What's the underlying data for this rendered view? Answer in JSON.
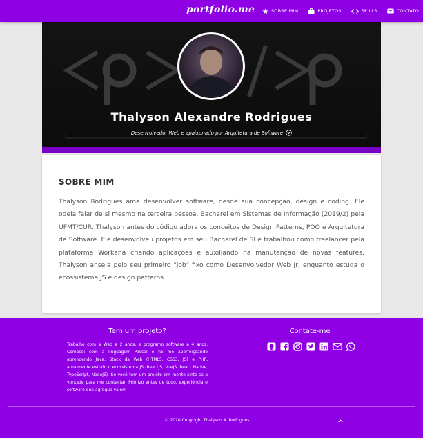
{
  "navbar": {
    "brand": "portfolio.me",
    "items": [
      {
        "label": "SOBRE MIM",
        "icon": "star-icon"
      },
      {
        "label": "PROJETOS",
        "icon": "briefcase-icon"
      },
      {
        "label": "SKILLS",
        "icon": "code-icon"
      },
      {
        "label": "CONTATO",
        "icon": "envelope-icon"
      }
    ]
  },
  "hero": {
    "name": "Thalyson Alexandre Rodrigues",
    "role": "Desenvolvedor Web e apaixonado por Arquitetura de Software",
    "role_icon": "chevron-circle-down-icon"
  },
  "about": {
    "title": "SOBRE MIM",
    "text": "Thalyson Rodrigues ama desenvolver software, desde sua concepção, design e coding. Ele odeia falar de si mesmo na terceira pessoa. Bacharel em Sistemas de Informação (2019/2) pela UFMT/CUR. Thalyson antes do código adora os conceitos de Design Patterns, POO e Arquitetura de Software. Ele desenvolveu projetos em seu Bacharel de SI e trabalhou como freelancer pela plataforma Workana criando aplicações e auxiliando na manutenção de novas features. Thalyson anseia pelo seu primeiro \"job\" fixo como Desenvolvedor Web Jr, enquanto estuda o ecossistema JS e design patterns."
  },
  "footer": {
    "project_title": "Tem um projeto?",
    "project_text": "Trabalho com a Web a 2 anos, e programo software a 4 anos. Comecei com a linguagem Pascal e fui me aperfeiçoando aprendendo Java, Stack da Web (HTML5, CSS3, JS) e PHP, atualmente estudo o ecossistema JS (ReactJS, VueJS, React Native, TypeScript, NodeJS). Se você tem um projeto em mente sinta-se a vontade para me contactar. Priorizo antes de tudo, experiência e software que agregue valor!",
    "contact_title": "Contate-me",
    "social_icons": [
      "github-icon",
      "facebook-icon",
      "instagram-icon",
      "twitter-icon",
      "linkedin-icon",
      "envelope-icon",
      "whatsapp-icon"
    ],
    "copyright": "© 2020 Copyright Thalyson A. Rodrigues"
  },
  "colors": {
    "primary": "#8f00e5",
    "card_bg": "#ffffff",
    "page_bg": "#e8e8e8",
    "hero_bg": "#111111"
  }
}
